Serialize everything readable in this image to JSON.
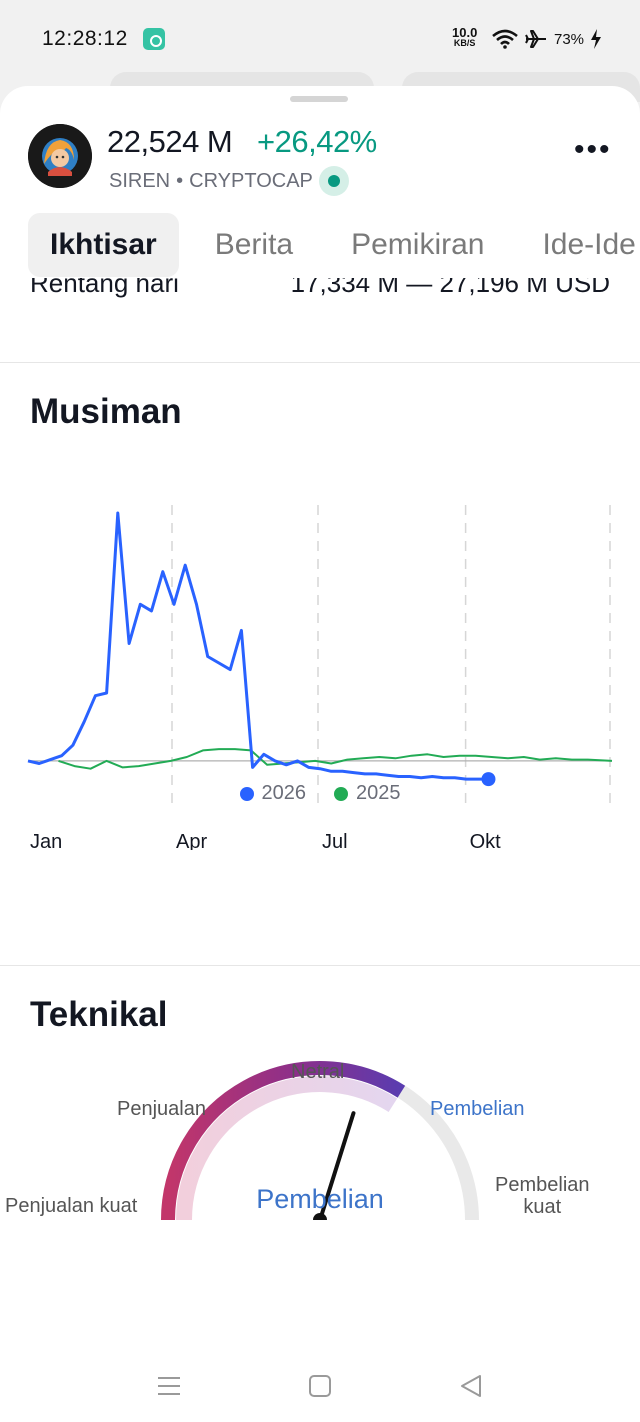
{
  "status_bar": {
    "time": "12:28:12",
    "net_speed": "10.0",
    "net_unit": "KB/S",
    "battery": "73%"
  },
  "header": {
    "price": "22,524 M",
    "change": "+26,42%",
    "symbol": "SIREN",
    "exchange": "CRYPTOCAP",
    "separator": "•",
    "change_color": "#089981"
  },
  "tabs": [
    "Ikhtisar",
    "Berita",
    "Pemikiran",
    "Ide-Ide"
  ],
  "range": {
    "label": "Rentang hari",
    "value": "17,334 M — 27,196 M USD"
  },
  "seasonal": {
    "title": "Musiman"
  },
  "chart_data": {
    "type": "line",
    "title": "Musiman",
    "x_ticks": [
      "Jan",
      "Apr",
      "Jul",
      "Okt"
    ],
    "series": [
      {
        "name": "2026",
        "color": "#2962ff",
        "x": [
          1,
          8,
          15,
          22,
          29,
          36,
          43,
          50,
          57,
          64,
          71,
          78,
          85,
          92,
          99,
          106,
          113,
          120,
          127,
          134,
          141,
          148,
          155,
          162,
          169,
          176,
          183,
          190,
          197,
          204,
          211,
          218,
          225,
          232,
          239,
          246,
          253,
          260,
          267,
          274,
          281,
          288
        ],
        "values": [
          0.0,
          -0.2,
          0.1,
          0.4,
          1.2,
          3.0,
          5.0,
          5.2,
          19.0,
          9.0,
          12.0,
          11.5,
          14.5,
          12.0,
          15.0,
          12.0,
          8.0,
          7.5,
          7.0,
          10.0,
          -0.5,
          0.5,
          0.0,
          -0.3,
          0.0,
          -0.5,
          -0.6,
          -0.8,
          -0.8,
          -0.9,
          -1.0,
          -1.0,
          -1.1,
          -1.2,
          -1.2,
          -1.3,
          -1.2,
          -1.3,
          -1.3,
          -1.4,
          -1.4,
          -1.4
        ]
      },
      {
        "name": "2025",
        "color": "#22ab55",
        "x": [
          20,
          30,
          40,
          50,
          60,
          70,
          80,
          90,
          100,
          110,
          120,
          130,
          140,
          150,
          160,
          170,
          180,
          190,
          200,
          210,
          220,
          230,
          240,
          250,
          260,
          270,
          280,
          290,
          300,
          310,
          320,
          330,
          340,
          350,
          365
        ],
        "values": [
          0.0,
          -0.4,
          -0.6,
          0.0,
          -0.5,
          -0.4,
          -0.2,
          0.0,
          0.3,
          0.8,
          0.9,
          0.9,
          0.8,
          -0.3,
          -0.2,
          -0.1,
          0.0,
          -0.2,
          0.1,
          0.2,
          0.3,
          0.2,
          0.4,
          0.5,
          0.3,
          0.4,
          0.4,
          0.3,
          0.2,
          0.3,
          0.1,
          0.2,
          0.1,
          0.1,
          0.0
        ]
      }
    ],
    "xlim": [
      1,
      365
    ],
    "ylim": [
      -3,
      20
    ],
    "grid": "vertical-dashed"
  },
  "legend": {
    "item1": "2026",
    "item2": "2025"
  },
  "technical": {
    "title": "Teknikal",
    "labels": {
      "strong_sell": "Penjualan kuat",
      "sell": "Penjualan",
      "neutral": "Netral",
      "buy": "Pembelian",
      "strong_buy_line1": "Pembelian",
      "strong_buy_line2": "kuat"
    },
    "result": "Pembelian",
    "gauge_value": 0.68
  }
}
